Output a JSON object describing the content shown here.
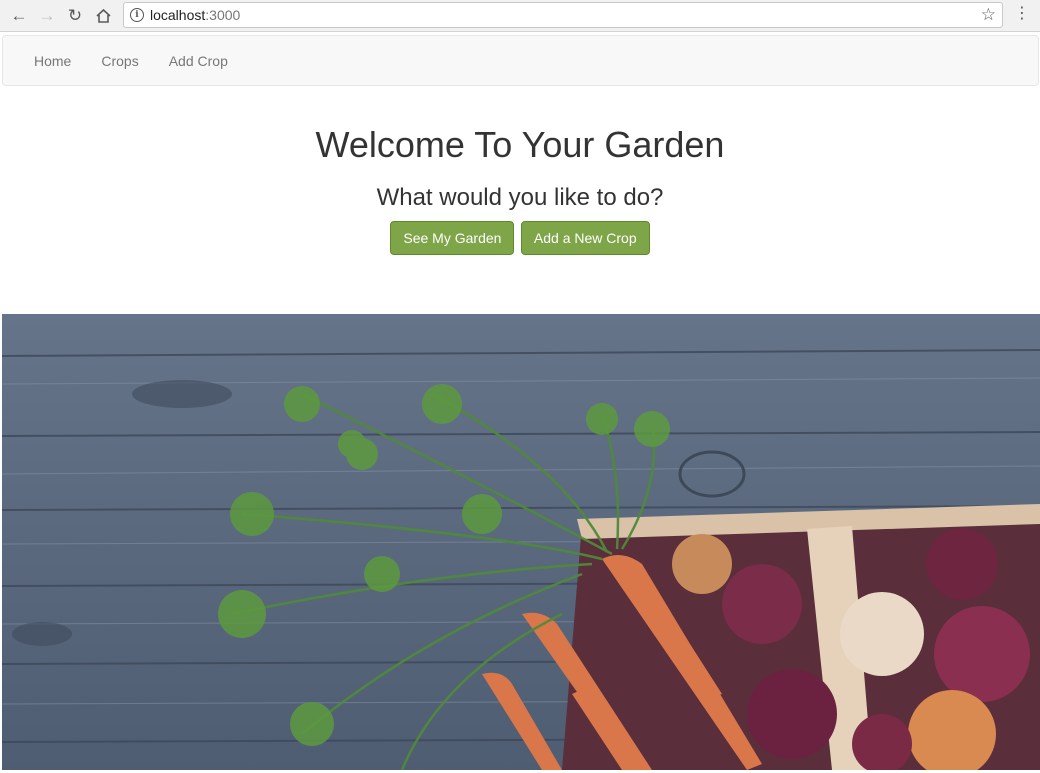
{
  "browser": {
    "url_host": "localhost",
    "url_port": ":3000",
    "icons": [
      "back-icon",
      "forward-icon",
      "reload-icon",
      "home-icon",
      "info-icon",
      "star-icon",
      "menu-icon"
    ]
  },
  "navbar": {
    "items": [
      {
        "label": "Home"
      },
      {
        "label": "Crops"
      },
      {
        "label": "Add Crop"
      }
    ]
  },
  "hero": {
    "title": "Welcome To Your Garden",
    "subtitle": "What would you like to do?",
    "primary_button": "See My Garden",
    "secondary_button": "Add a New Crop"
  },
  "colors": {
    "button": "#7ea548",
    "navbar_bg": "#f8f8f8",
    "wood": "#5b6a80"
  }
}
